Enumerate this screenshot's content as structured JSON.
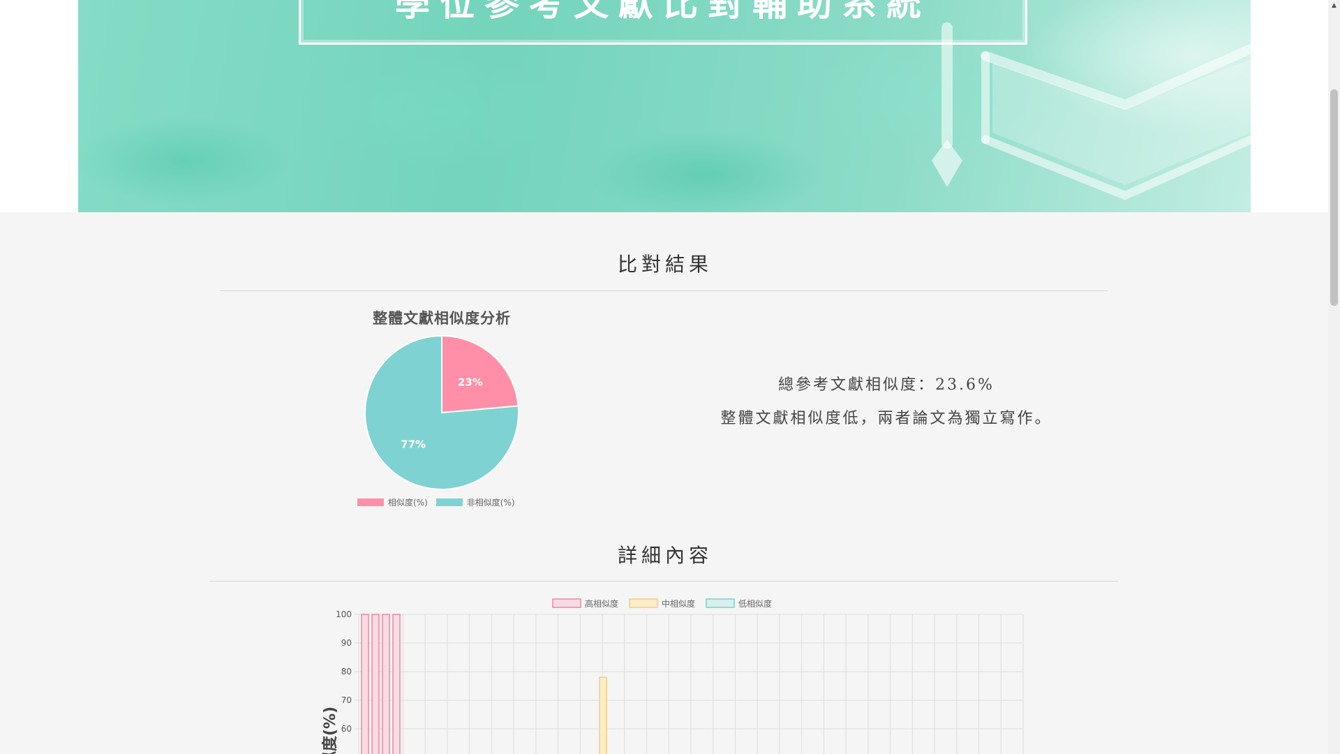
{
  "header": {
    "title": "學位參考文獻比對輔助系統",
    "decoration_icon": "graduation-cap-icon"
  },
  "results_section": {
    "title": "比對結果"
  },
  "pie_chart": {
    "title": "整體文獻相似度分析",
    "legend": [
      {
        "label": "相似度(%)",
        "color": "#ff8fa8"
      },
      {
        "label": "非相似度(%)",
        "color": "#7fd2d2"
      }
    ]
  },
  "summary": {
    "total_similarity": "總參考文獻相似度：23.6%",
    "conclusion": "整體文獻相似度低，兩者論文為獨立寫作。"
  },
  "details_section": {
    "title": "詳細內容"
  },
  "bar_chart": {
    "legend": [
      {
        "label": "高相似度",
        "fill": "#fadbe3",
        "stroke": "#e88aa2"
      },
      {
        "label": "中相似度",
        "fill": "#fcecc8",
        "stroke": "#f0cf7e"
      },
      {
        "label": "低相似度",
        "fill": "#d7efef",
        "stroke": "#7fcfcf"
      }
    ],
    "ylabel": "相似度(%)"
  },
  "chart_data": [
    {
      "type": "pie",
      "title": "整體文獻相似度分析",
      "categories": [
        "相似度(%)",
        "非相似度(%)"
      ],
      "values": [
        23.6,
        76.4
      ],
      "data_labels": [
        "23%",
        "77%"
      ],
      "colors": [
        "#ff8fa8",
        "#7fd2d2"
      ],
      "legend_position": "bottom"
    },
    {
      "type": "bar",
      "title": "",
      "ylabel": "相似度(%)",
      "xlabel": "",
      "ylim": [
        50,
        100
      ],
      "yticks": [
        100,
        90,
        80,
        70,
        60
      ],
      "grid": true,
      "legend_position": "top",
      "series": [
        {
          "name": "高相似度",
          "values": [
            100,
            100,
            100,
            100
          ]
        },
        {
          "name": "中相似度",
          "values": [
            78
          ]
        },
        {
          "name": "低相似度",
          "values": []
        }
      ],
      "bars": [
        {
          "series": "高相似度",
          "slot": 0,
          "value": 100
        },
        {
          "series": "高相似度",
          "slot": 1,
          "value": 100
        },
        {
          "series": "高相似度",
          "slot": 2,
          "value": 100
        },
        {
          "series": "高相似度",
          "slot": 3,
          "value": 100
        },
        {
          "series": "中相似度",
          "slot": 11,
          "value": 78
        }
      ],
      "slot_count": 30
    }
  ],
  "scrollbar": {
    "up_icon": "scroll-up-arrow-icon"
  }
}
